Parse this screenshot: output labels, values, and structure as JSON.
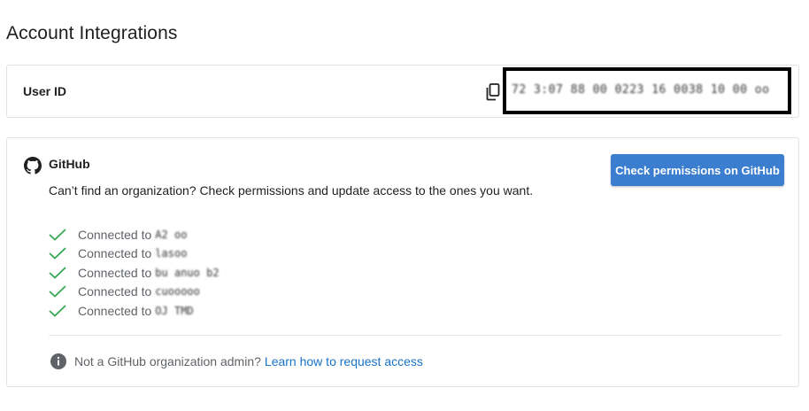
{
  "page": {
    "title": "Account Integrations"
  },
  "user_id": {
    "label": "User ID",
    "value": "72 3:07 88 00 0223 16 0038 10 00 oo",
    "copy_icon": "copy-icon"
  },
  "github": {
    "title": "GitHub",
    "icon": "github-icon",
    "description": "Can’t find an organization? Check permissions and update access to the ones you want.",
    "button_label": "Check permissions on GitHub",
    "connections": [
      {
        "prefix": "Connected to",
        "name": "A2 oo"
      },
      {
        "prefix": "Connected to",
        "name": "lasoo"
      },
      {
        "prefix": "Connected to",
        "name": "bu anuo b2"
      },
      {
        "prefix": "Connected to",
        "name": "cuooooo"
      },
      {
        "prefix": "Connected to",
        "name": "OJ TMD"
      }
    ],
    "admin_text": "Not a GitHub organization admin?",
    "admin_link": "Learn how to request access"
  },
  "colors": {
    "accent": "#3b7ed0",
    "link": "#1a73c8",
    "check": "#34a853"
  }
}
